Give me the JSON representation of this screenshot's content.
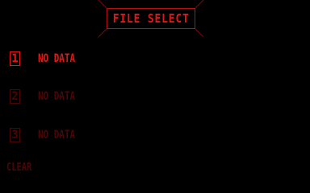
{
  "title": "FILE SELECT",
  "slots": [
    {
      "number": "1",
      "label": "NO DATA",
      "state": "selected"
    },
    {
      "number": "2",
      "label": "NO DATA",
      "state": "dim"
    },
    {
      "number": "3",
      "label": "NO DATA",
      "state": "dim"
    }
  ],
  "clear_label": "CLEAR",
  "colors": {
    "background": "#000000",
    "active_red": "#e01818",
    "dim_red": "#4a0606",
    "frame_red": "#b41010"
  }
}
